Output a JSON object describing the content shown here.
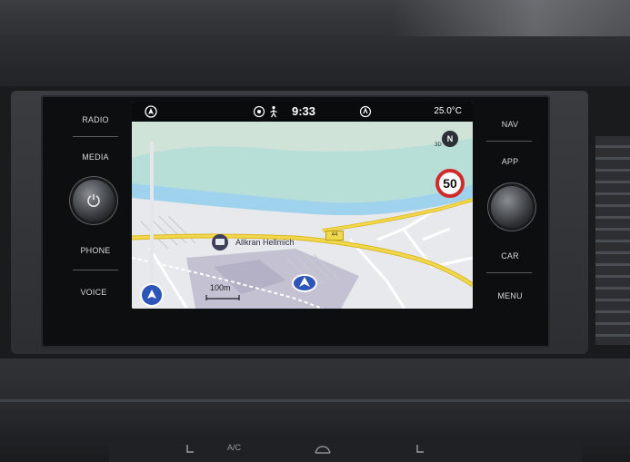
{
  "hardware_left": {
    "radio": "RADIO",
    "media": "MEDIA",
    "phone": "PHONE",
    "voice": "VOICE"
  },
  "hardware_right": {
    "nav": "NAV",
    "app": "APP",
    "car": "CAR",
    "menu": "MENU"
  },
  "status_bar": {
    "time": "9:33",
    "temperature": "25.0°C"
  },
  "map": {
    "poi_label": "Allkran Hellmich",
    "speed_limit": "50",
    "scale": "100m",
    "street_number": "44",
    "compass": "N",
    "compass_mode": "3D"
  },
  "climate_controls": {
    "ac": "A/C"
  },
  "colors": {
    "water": "#a8d9f5",
    "land": "#b9d9d3",
    "road_major": "#f1d74a",
    "speed_ring": "#d12a2a",
    "position_marker": "#2b55b8"
  }
}
